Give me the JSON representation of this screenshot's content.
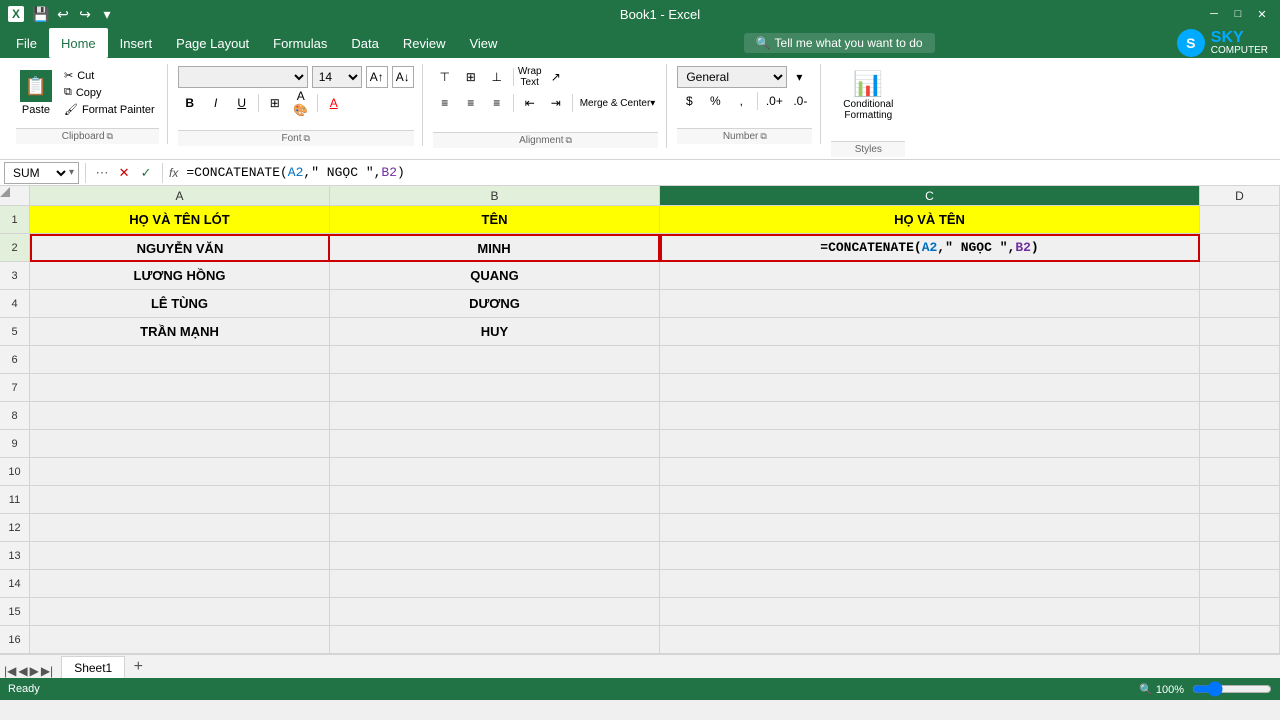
{
  "titlebar": {
    "title": "Book1 - Excel",
    "quickaccess": [
      "save",
      "undo",
      "redo",
      "customize"
    ]
  },
  "menubar": {
    "items": [
      "File",
      "Home",
      "Insert",
      "Page Layout",
      "Formulas",
      "Data",
      "Review",
      "View"
    ],
    "active": "Home",
    "search_placeholder": "Tell me what you want to do"
  },
  "ribbon": {
    "clipboard": {
      "label": "Clipboard",
      "paste_label": "Paste",
      "cut_label": "Cut",
      "copy_label": "Copy",
      "format_painter_label": "Format Painter"
    },
    "font": {
      "label": "Font",
      "font_name": "",
      "font_size": "14",
      "bold": "B",
      "italic": "I",
      "underline": "U"
    },
    "alignment": {
      "label": "Alignment",
      "wrap_text": "Wrap Text",
      "merge_center": "Merge & Center"
    },
    "number": {
      "label": "Number",
      "format": "General"
    },
    "conditional": {
      "label": "Condition Formatting",
      "short_label": "Conditional\nFormatting"
    }
  },
  "formulabar": {
    "namebox": "SUM",
    "formula": "=CONCATENATE(A2,\" NGỌC \",B2)"
  },
  "grid": {
    "columns": [
      "A",
      "B",
      "C",
      "D"
    ],
    "rows": [
      {
        "num": 1,
        "cells": [
          "HỌ VÀ TÊN LÓT",
          "TÊN",
          "HỌ VÀ TÊN",
          ""
        ]
      },
      {
        "num": 2,
        "cells": [
          "NGUYỄN VĂN",
          "MINH",
          "=CONCATENATE(A2,\" NGỌC \",B2)",
          ""
        ]
      },
      {
        "num": 3,
        "cells": [
          "LƯƠNG HỒNG",
          "QUANG",
          "",
          ""
        ]
      },
      {
        "num": 4,
        "cells": [
          "LÊ TÙNG",
          "DƯƠNG",
          "",
          ""
        ]
      },
      {
        "num": 5,
        "cells": [
          "TRẦN MẠNH",
          "HUY",
          "",
          ""
        ]
      },
      {
        "num": 6,
        "cells": [
          "",
          "",
          "",
          ""
        ]
      },
      {
        "num": 7,
        "cells": [
          "",
          "",
          "",
          ""
        ]
      },
      {
        "num": 8,
        "cells": [
          "",
          "",
          "",
          ""
        ]
      },
      {
        "num": 9,
        "cells": [
          "",
          "",
          "",
          ""
        ]
      },
      {
        "num": 10,
        "cells": [
          "",
          "",
          "",
          ""
        ]
      },
      {
        "num": 11,
        "cells": [
          "",
          "",
          "",
          ""
        ]
      },
      {
        "num": 12,
        "cells": [
          "",
          "",
          "",
          ""
        ]
      },
      {
        "num": 13,
        "cells": [
          "",
          "",
          "",
          ""
        ]
      },
      {
        "num": 14,
        "cells": [
          "",
          "",
          "",
          ""
        ]
      },
      {
        "num": 15,
        "cells": [
          "",
          "",
          "",
          ""
        ]
      },
      {
        "num": 16,
        "cells": [
          "",
          "",
          "",
          ""
        ]
      }
    ],
    "active_cell": "C2",
    "sheet_tabs": [
      "Sheet1"
    ],
    "active_sheet": "Sheet1"
  },
  "statusbar": {
    "mode": "Ready"
  },
  "logo": {
    "icon": "S",
    "sky": "SKY",
    "computer": "COMPUTER"
  }
}
